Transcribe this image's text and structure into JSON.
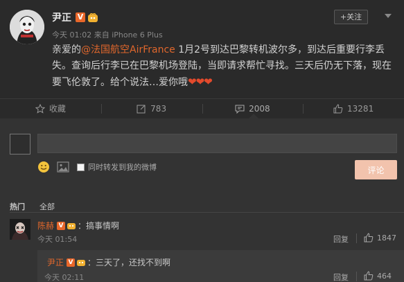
{
  "post": {
    "author": "尹正",
    "verified_badge": "V",
    "meta": "今天 01:02 来自 iPhone 6 Plus",
    "follow_label": "+关注",
    "text_prefix": "亲爱的",
    "mention": "@法国航空AirFrance",
    "text_body": " 1月2号到达巴黎转机波尔多，到达后重要行李丢失。查询后行李已在巴黎机场登陆，当即请求帮忙寻找。三天后仍无下落，现在要飞伦敦了。给个说法…爱你哦",
    "hearts": "❤❤❤"
  },
  "actions": {
    "favorite": "收藏",
    "repost_count": "783",
    "comment_count": "2008",
    "like_count": "13281"
  },
  "composer": {
    "placeholder": "",
    "repost_label": "同时转发到我的微博",
    "submit_label": "评论"
  },
  "tabs": {
    "hot": "热门",
    "all": "全部"
  },
  "comments": [
    {
      "user": "陈赫",
      "verified_badge": "V",
      "text": "：搞事情啊",
      "time": "今天 01:54",
      "reply_label": "回复",
      "likes": "1847"
    },
    {
      "user": "尹正",
      "verified_badge": "V",
      "text": "：三天了，还找不到啊",
      "time": "今天 02:11",
      "reply_label": "回复",
      "likes": "464"
    }
  ],
  "colors": {
    "background": "#2a2a2a",
    "accent": "#e0672c",
    "submit": "#f2c3ad"
  }
}
